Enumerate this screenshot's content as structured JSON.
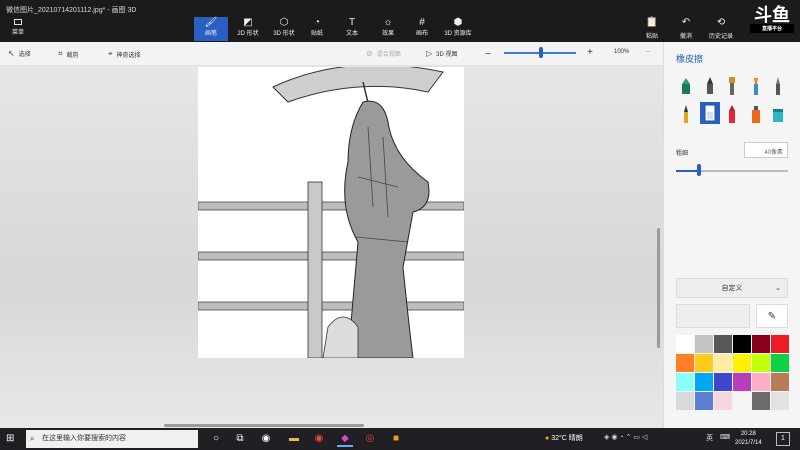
{
  "window": {
    "title": "微信图片_20210714201112.jpg* - 画图 3D"
  },
  "menu": {
    "label": "菜单"
  },
  "tools": [
    {
      "label": "画笔",
      "icon": "brush-icon"
    },
    {
      "label": "2D 形状",
      "icon": "shapes-2d-icon"
    },
    {
      "label": "3D 形状",
      "icon": "cube-icon"
    },
    {
      "label": "贴纸",
      "icon": "sticker-icon"
    },
    {
      "label": "文本",
      "icon": "text-icon"
    },
    {
      "label": "效果",
      "icon": "effects-icon"
    },
    {
      "label": "画布",
      "icon": "canvas-icon"
    },
    {
      "label": "3D 资源库",
      "icon": "library-icon"
    }
  ],
  "right_tools": [
    {
      "label": "粘贴",
      "icon": "paste-icon"
    },
    {
      "label": "撤消",
      "icon": "undo-icon"
    },
    {
      "label": "历史记录",
      "icon": "history-icon"
    }
  ],
  "logo": {
    "text": "斗鱼",
    "subtitle": "直播平台"
  },
  "toolbar2": {
    "select": "选择",
    "crop": "裁剪",
    "magic_select": "神奇选择",
    "paste_disabled": "混合视图",
    "view_3d": "3D 视图",
    "zoom_percent": "100%",
    "zoom_level": 0.55,
    "more": "···"
  },
  "panel": {
    "title": "橡皮擦",
    "thickness_label": "粗细",
    "thickness_value": "40像素",
    "thickness_level": 0.2,
    "custom_label": "自定义",
    "picker_icon": "eyedropper-icon",
    "swatch_colors": [
      "#ffffff",
      "#c3c3c3",
      "#585858",
      "#000000",
      "#88001b",
      "#ec1c24",
      "#ff7f27",
      "#ffca18",
      "#fdeca6",
      "#fff200",
      "#c4ff0e",
      "#0ed145",
      "#8cfffb",
      "#00a8f3",
      "#3f48cc",
      "#b83dba",
      "#ffaec8",
      "#b97a56",
      "#d9d9d9",
      "#5b7fd0",
      "#f6d6dc",
      "#f4f4f4",
      "#6b6b6b",
      "#e2e2e2"
    ]
  },
  "taskbar": {
    "search_placeholder": "在这里输入你要搜索的内容",
    "weather": "32°C 晴朗",
    "lang": "英",
    "time": "20:28",
    "date": "2021/7/14",
    "notif_count": "1"
  }
}
